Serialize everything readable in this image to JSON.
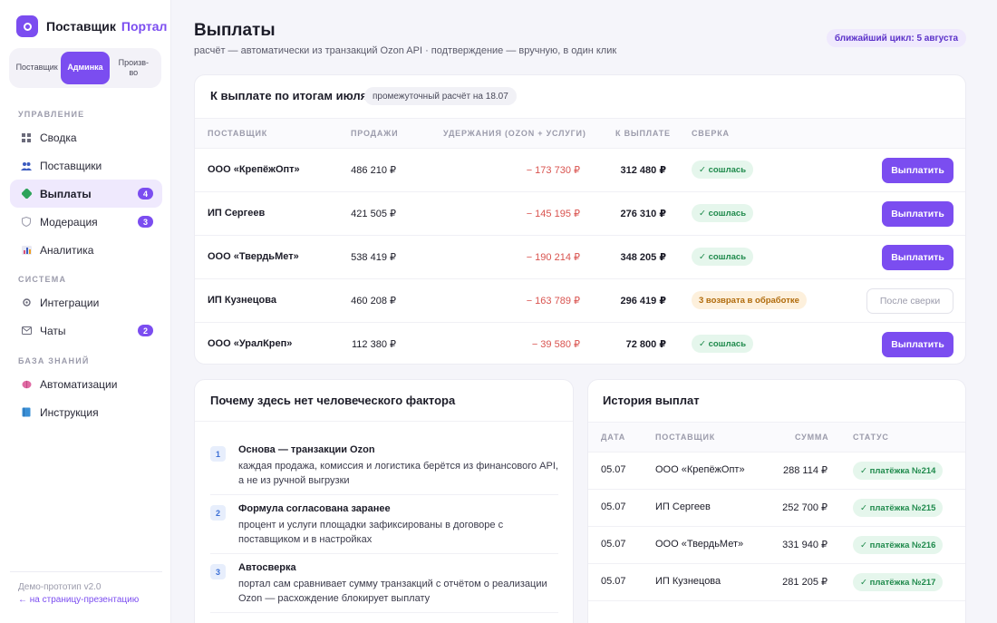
{
  "brand": {
    "name": "Поставщик",
    "accent": "Портал"
  },
  "roles": [
    {
      "label": "Поставщик",
      "active": false
    },
    {
      "label": "Админка",
      "active": true
    },
    {
      "label": "Произв-во",
      "active": false
    }
  ],
  "nav": {
    "section_manage": "УПРАВЛЕНИЕ",
    "section_system": "СИСТЕМА",
    "section_kb": "БАЗА ЗНАНИЙ",
    "items": [
      {
        "label": "Сводка",
        "icon": "grid-icon"
      },
      {
        "label": "Поставщики",
        "icon": "people-icon"
      },
      {
        "label": "Выплаты",
        "icon": "money-icon",
        "badge": "4",
        "active": true
      },
      {
        "label": "Модерация",
        "icon": "shield-icon",
        "badge": "3"
      },
      {
        "label": "Аналитика",
        "icon": "chart-icon"
      },
      {
        "label": "Интеграции",
        "icon": "gear-icon"
      },
      {
        "label": "Чаты",
        "icon": "mail-icon",
        "badge": "2"
      },
      {
        "label": "Автоматизации",
        "icon": "brain-icon"
      },
      {
        "label": "Инструкция",
        "icon": "book-icon"
      }
    ]
  },
  "footer": {
    "note": "Демо-прототип v2.0",
    "link": "← на страницу-презентацию"
  },
  "header": {
    "title": "Выплаты",
    "subtitle": "расчёт — автоматически из транзакций Ozon API · подтверждение — вручную, в один клик",
    "cycle": "ближайший цикл: 5 августа"
  },
  "payout": {
    "title": "К выплате по итогам июля",
    "calc_note": "промежуточный расчёт на 18.07",
    "columns": [
      "ПОСТАВЩИК",
      "ПРОДАЖИ",
      "УДЕРЖАНИЯ (OZON + УСЛУГИ)",
      "К ВЫПЛАТЕ",
      "СВЕРКА"
    ],
    "rows": [
      {
        "supplier": "ООО «КрепёжОпт»",
        "sales": "486 210 ₽",
        "deductions": "− 173 730 ₽",
        "payout": "312 480 ₽",
        "status": "✓ сошлась",
        "status_type": "ok",
        "action": "Выплатить"
      },
      {
        "supplier": "ИП Сергеев",
        "sales": "421 505 ₽",
        "deductions": "− 145 195 ₽",
        "payout": "276 310 ₽",
        "status": "✓ сошлась",
        "status_type": "ok",
        "action": "Выплатить"
      },
      {
        "supplier": "ООО «ТвердьМет»",
        "sales": "538 419 ₽",
        "deductions": "− 190 214 ₽",
        "payout": "348 205 ₽",
        "status": "✓ сошлась",
        "status_type": "ok",
        "action": "Выплатить"
      },
      {
        "supplier": "ИП Кузнецова",
        "sales": "460 208 ₽",
        "deductions": "− 163 789 ₽",
        "payout": "296 419 ₽",
        "status": "3 возврата в обработке",
        "status_type": "warn",
        "action": "После сверки"
      },
      {
        "supplier": "ООО «УралКреп»",
        "sales": "112 380 ₽",
        "deductions": "− 39 580 ₽",
        "payout": "72 800 ₽",
        "status": "✓ сошлась",
        "status_type": "ok",
        "action": "Выплатить"
      }
    ]
  },
  "why": {
    "title": "Почему здесь нет человеческого фактора",
    "items": [
      {
        "num": "1",
        "title": "Основа — транзакции Ozon",
        "text": "каждая продажа, комиссия и логистика берётся из финансового API, а не из ручной выгрузки"
      },
      {
        "num": "2",
        "title": "Формула согласована заранее",
        "text": "процент и услуги площадки зафиксированы в договоре с поставщиком и в настройках"
      },
      {
        "num": "3",
        "title": "Автосверка",
        "text": "портал сам сравнивает сумму транзакций с отчётом о реализации Ozon — расхождение блокирует выплату"
      }
    ]
  },
  "history": {
    "title": "История выплат",
    "columns": [
      "ДАТА",
      "ПОСТАВЩИК",
      "СУММА",
      "СТАТУС"
    ],
    "rows": [
      {
        "date": "05.07",
        "supplier": "ООО «КрепёжОпт»",
        "amount": "288 114 ₽",
        "status": "✓ платёжка №214"
      },
      {
        "date": "05.07",
        "supplier": "ИП Сергеев",
        "amount": "252 700 ₽",
        "status": "✓ платёжка №215"
      },
      {
        "date": "05.07",
        "supplier": "ООО «ТвердьМет»",
        "amount": "331 940 ₽",
        "status": "✓ платёжка №216"
      },
      {
        "date": "05.07",
        "supplier": "ИП Кузнецова",
        "amount": "281 205 ₽",
        "status": "✓ платёжка №217"
      }
    ]
  },
  "colors": {
    "accent": "#7b4df0",
    "ok": "#1f8a4c",
    "warn": "#b06a0a",
    "negative": "#d9534f"
  }
}
